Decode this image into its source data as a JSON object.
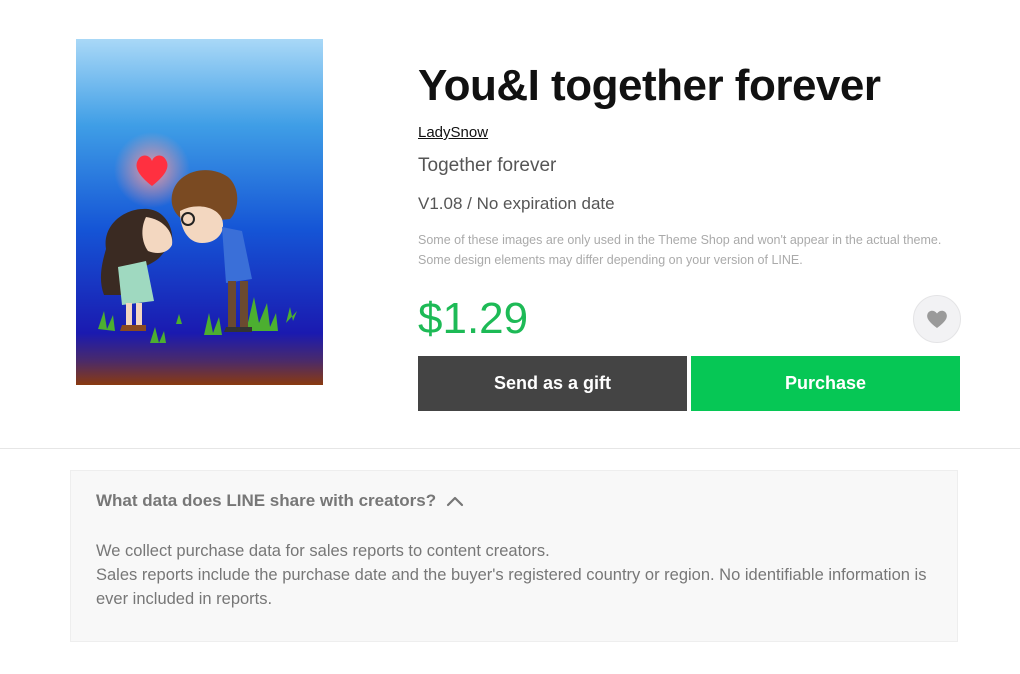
{
  "product": {
    "title": "You&I together forever",
    "author": "LadySnow",
    "subtitle": "Together forever",
    "version": "V1.08 / No expiration date",
    "notice": "Some of these images are only used in the Theme Shop and won't appear in the actual theme. Some design elements may differ depending on your version of LINE.",
    "price": "$1.29"
  },
  "actions": {
    "gift_label": "Send as a gift",
    "purchase_label": "Purchase",
    "favorite_icon": "heart-icon"
  },
  "disclosure": {
    "question": "What data does LINE share with creators?",
    "toggle_icon": "chevron-up-icon",
    "line1": "We collect purchase data for sales reports to content creators.",
    "line2": "Sales reports include the purchase date and the buyer's registered country or region. No identifiable information is ever included in reports."
  },
  "colors": {
    "price": "#1dba56",
    "purchase_button": "#06c755",
    "gift_button": "#444444"
  }
}
